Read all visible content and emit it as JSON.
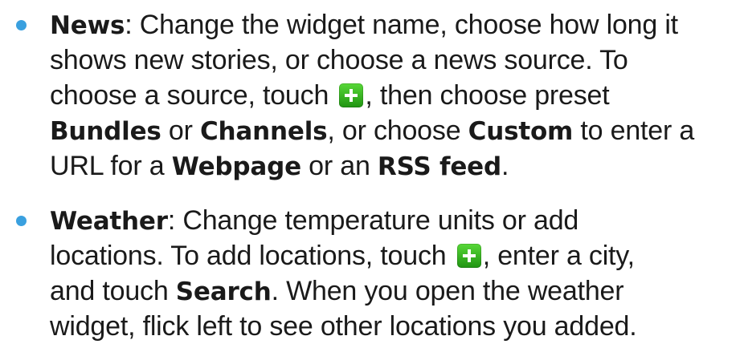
{
  "items": [
    {
      "term": "News",
      "lines": [
        {
          "pre": ": Change the widget name, choose how long it"
        },
        {
          "text": "shows new stories, or choose a news source. To"
        },
        {
          "pre": "choose a source, touch ",
          "icon": "plus-icon",
          "post": ", then choose preset"
        },
        {
          "b1": "Bundles",
          "t1": " or ",
          "b2": "Channels",
          "t2": ", or choose ",
          "b3": "Custom",
          "t3": " to enter a"
        },
        {
          "t0": "URL for a ",
          "b1": "Webpage",
          "t1": " or an ",
          "b2": "RSS feed",
          "t2": "."
        }
      ]
    },
    {
      "term": "Weather",
      "lines": [
        {
          "pre": ": Change temperature units or add"
        },
        {
          "pre": "locations. To add locations, touch ",
          "icon": "plus-icon",
          "post": ", enter a city,"
        },
        {
          "t0": "and touch ",
          "b1": "Search",
          "t1": ". When you open the weather"
        },
        {
          "text": "widget, flick left to see other locations you added."
        }
      ]
    }
  ],
  "colors": {
    "bullet": "#3aa0df",
    "icon": "#2fb41c",
    "text": "#1a1a1a"
  }
}
